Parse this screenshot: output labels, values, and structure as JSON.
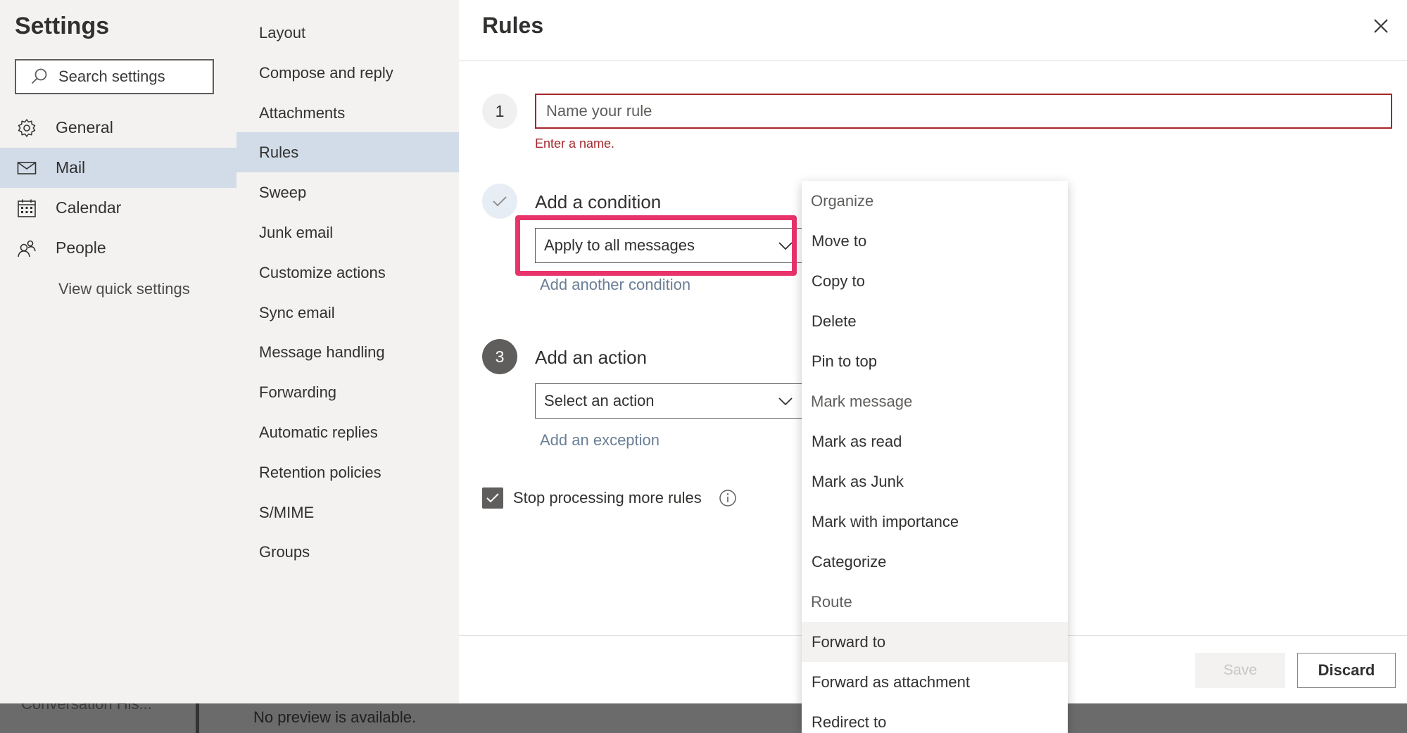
{
  "backdrop": {
    "preview_text": "No preview is available.",
    "partial_text": "Conversation His..."
  },
  "settings": {
    "title": "Settings",
    "search_placeholder": "Search settings",
    "nav": [
      {
        "label": "General",
        "icon": "gear-icon"
      },
      {
        "label": "Mail",
        "icon": "mail-icon",
        "selected": true
      },
      {
        "label": "Calendar",
        "icon": "calendar-icon"
      },
      {
        "label": "People",
        "icon": "people-icon"
      }
    ],
    "view_quick_settings": "View quick settings"
  },
  "mail_nav": {
    "items": [
      {
        "label": "Layout"
      },
      {
        "label": "Compose and reply"
      },
      {
        "label": "Attachments"
      },
      {
        "label": "Rules",
        "selected": true
      },
      {
        "label": "Sweep"
      },
      {
        "label": "Junk email"
      },
      {
        "label": "Customize actions"
      },
      {
        "label": "Sync email"
      },
      {
        "label": "Message handling"
      },
      {
        "label": "Forwarding"
      },
      {
        "label": "Automatic replies"
      },
      {
        "label": "Retention policies"
      },
      {
        "label": "S/MIME"
      },
      {
        "label": "Groups"
      }
    ]
  },
  "rules": {
    "title": "Rules",
    "step1": "1",
    "step3": "3",
    "name_placeholder": "Name your rule",
    "name_error": "Enter a name.",
    "condition_label": "Add a condition",
    "condition_value": "Apply to all messages",
    "add_condition": "Add another condition",
    "action_label": "Add an action",
    "action_placeholder": "Select an action",
    "add_exception": "Add an exception",
    "stop_processing": "Stop processing more rules",
    "stop_processing_checked": true,
    "save": "Save",
    "discard": "Discard"
  },
  "action_menu": {
    "items": [
      {
        "label": "Organize",
        "type": "header"
      },
      {
        "label": "Move to",
        "type": "item"
      },
      {
        "label": "Copy to",
        "type": "item"
      },
      {
        "label": "Delete",
        "type": "item"
      },
      {
        "label": "Pin to top",
        "type": "item"
      },
      {
        "label": "Mark message",
        "type": "header"
      },
      {
        "label": "Mark as read",
        "type": "item"
      },
      {
        "label": "Mark as Junk",
        "type": "item"
      },
      {
        "label": "Mark with importance",
        "type": "item"
      },
      {
        "label": "Categorize",
        "type": "item"
      },
      {
        "label": "Route",
        "type": "header"
      },
      {
        "label": "Forward to",
        "type": "item",
        "hovered": true
      },
      {
        "label": "Forward as attachment",
        "type": "item"
      },
      {
        "label": "Redirect to",
        "type": "item"
      }
    ]
  },
  "colors": {
    "accent_highlight": "#e8336b",
    "error": "#a4262c",
    "selected_bg": "#d1dce8"
  }
}
